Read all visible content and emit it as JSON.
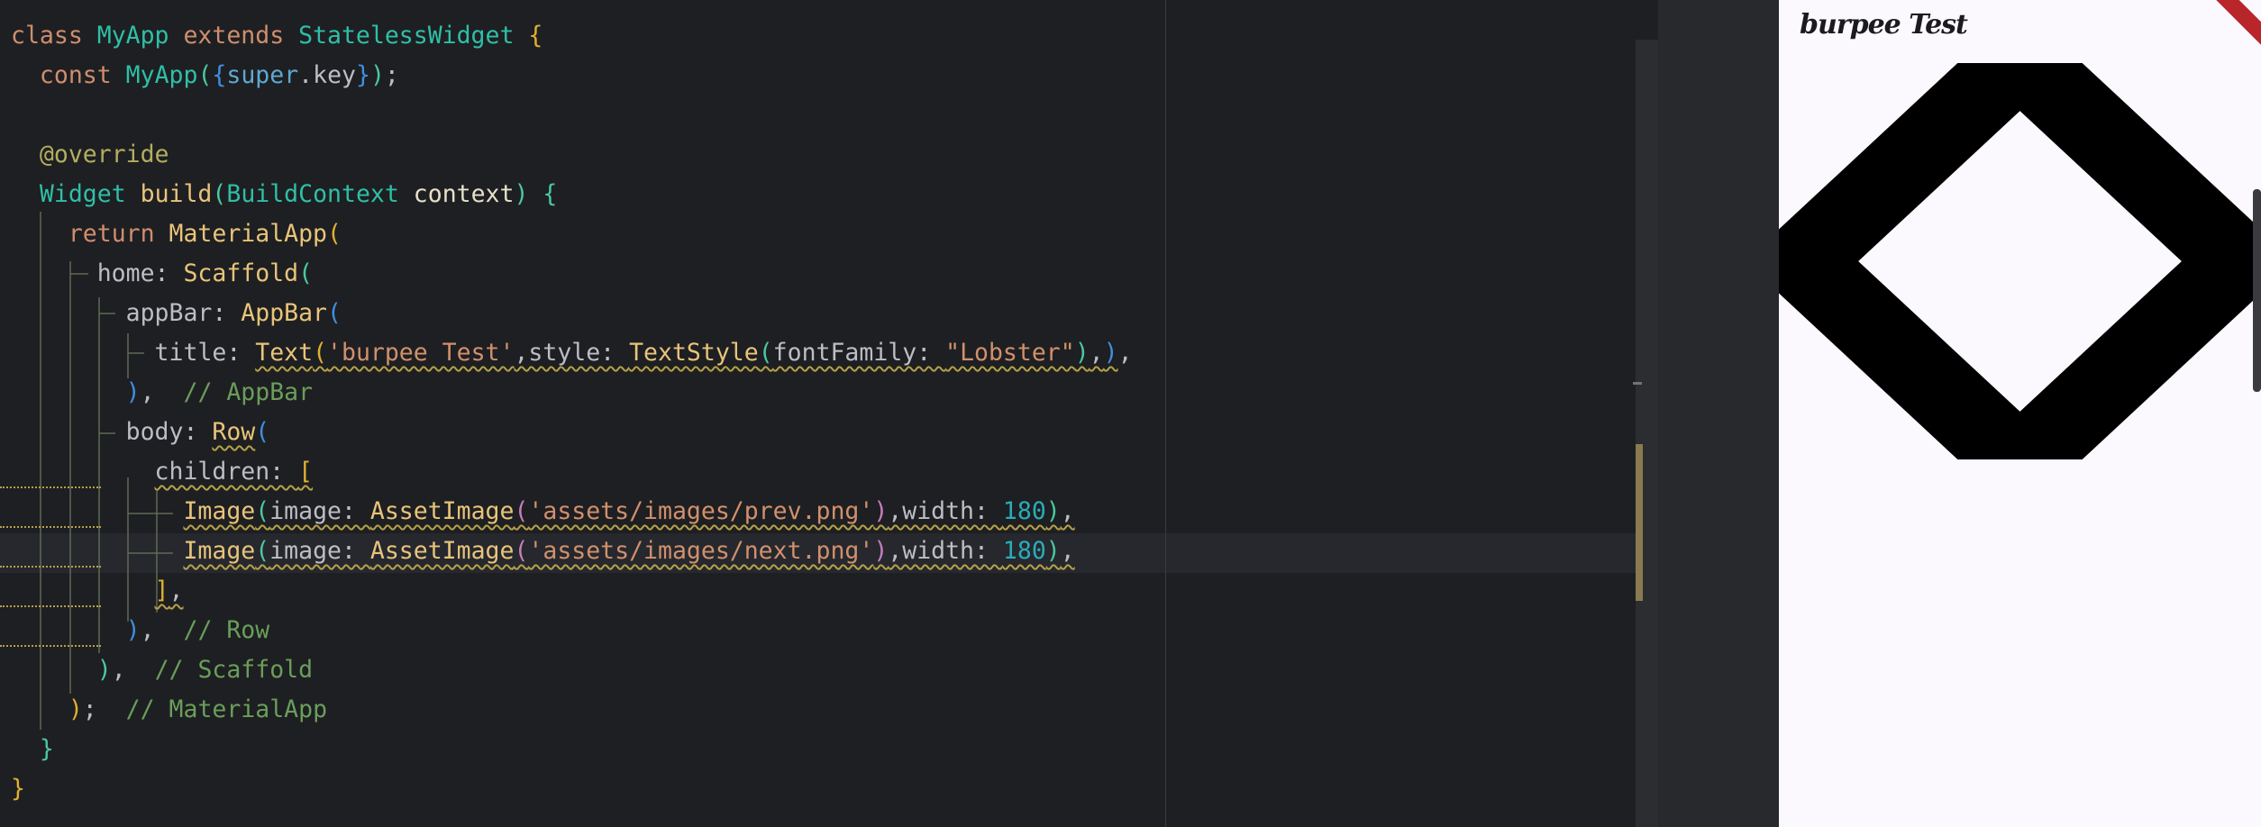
{
  "editor": {
    "lines": [
      {
        "warn": false,
        "tokens": [
          {
            "t": "class ",
            "c": "c-kw"
          },
          {
            "t": "MyApp ",
            "c": "c-type"
          },
          {
            "t": "extends ",
            "c": "c-kw"
          },
          {
            "t": "StatelessWidget ",
            "c": "c-type"
          },
          {
            "t": "{",
            "c": "c-p1"
          }
        ]
      },
      {
        "warn": false,
        "tokens": [
          {
            "t": "  "
          },
          {
            "t": "const ",
            "c": "c-kw"
          },
          {
            "t": "MyApp",
            "c": "c-type"
          },
          {
            "t": "(",
            "c": "c-p2"
          },
          {
            "t": "{",
            "c": "c-p3"
          },
          {
            "t": "super",
            "c": "c-kw2"
          },
          {
            "t": ".key"
          },
          {
            "t": "}",
            "c": "c-p3"
          },
          {
            "t": ")",
            "c": "c-p2"
          },
          {
            "t": ";"
          }
        ]
      },
      {
        "warn": false,
        "tokens": []
      },
      {
        "warn": false,
        "tokens": [
          {
            "t": "  "
          },
          {
            "t": "@override",
            "c": "c-ann"
          }
        ]
      },
      {
        "warn": false,
        "tokens": [
          {
            "t": "  "
          },
          {
            "t": "Widget ",
            "c": "c-type"
          },
          {
            "t": "build",
            "c": "c-fn"
          },
          {
            "t": "(",
            "c": "c-p2"
          },
          {
            "t": "BuildContext ",
            "c": "c-type"
          },
          {
            "t": "context",
            "c": "c-prm"
          },
          {
            "t": ") ",
            "c": "c-p2"
          },
          {
            "t": "{",
            "c": "c-p2"
          }
        ]
      },
      {
        "warn": false,
        "tokens": [
          {
            "t": "    "
          },
          {
            "t": "return ",
            "c": "c-kw"
          },
          {
            "t": "MaterialApp",
            "c": "c-fn"
          },
          {
            "t": "(",
            "c": "c-p1"
          }
        ]
      },
      {
        "warn": false,
        "tokens": [
          {
            "t": "      home: "
          },
          {
            "t": "Scaffold",
            "c": "c-fn"
          },
          {
            "t": "(",
            "c": "c-p2"
          }
        ]
      },
      {
        "warn": false,
        "tokens": [
          {
            "t": "        appBar: "
          },
          {
            "t": "AppBar",
            "c": "c-fn"
          },
          {
            "t": "(",
            "c": "c-p3"
          }
        ]
      },
      {
        "warn": false,
        "tokens": [
          {
            "t": "          title: "
          },
          {
            "t": "Text",
            "c": "c-fn",
            "w": true
          },
          {
            "t": "(",
            "c": "c-p1",
            "w": true
          },
          {
            "t": "'burpee Test'",
            "c": "c-str",
            "w": true
          },
          {
            "t": ",style: ",
            "w": true
          },
          {
            "t": "TextStyle",
            "c": "c-fn",
            "w": true
          },
          {
            "t": "(",
            "c": "c-p2",
            "w": true
          },
          {
            "t": "fontFamily: ",
            "w": true
          },
          {
            "t": "\"Lobster\"",
            "c": "c-str",
            "w": true
          },
          {
            "t": ")",
            "c": "c-p2",
            "w": true
          },
          {
            "t": ",",
            "w": true
          },
          {
            "t": ")",
            "c": "c-p3",
            "w": true
          },
          {
            "t": ","
          }
        ]
      },
      {
        "warn": false,
        "tokens": [
          {
            "t": "        "
          },
          {
            "t": ")",
            "c": "c-p3"
          },
          {
            "t": ",  "
          },
          {
            "t": "// AppBar",
            "c": "c-cm"
          }
        ]
      },
      {
        "warn": false,
        "tokens": [
          {
            "t": "        body: "
          },
          {
            "t": "Row",
            "c": "c-fn",
            "w": true
          },
          {
            "t": "(",
            "c": "c-p3"
          }
        ]
      },
      {
        "warn": true,
        "tokens": [
          {
            "t": "          "
          },
          {
            "t": "children: ",
            "w": true
          },
          {
            "t": "[",
            "c": "c-p1",
            "w": true
          }
        ]
      },
      {
        "warn": true,
        "tokens": [
          {
            "t": "            "
          },
          {
            "t": "Image",
            "c": "c-fn",
            "w": true
          },
          {
            "t": "(",
            "c": "c-p2",
            "w": true
          },
          {
            "t": "image: ",
            "w": true
          },
          {
            "t": "AssetImage",
            "c": "c-fn",
            "w": true
          },
          {
            "t": "(",
            "c": "c-p4",
            "w": true
          },
          {
            "t": "'assets/images/prev.png'",
            "c": "c-str",
            "w": true
          },
          {
            "t": ")",
            "c": "c-p4",
            "w": true
          },
          {
            "t": ",width: ",
            "w": true
          },
          {
            "t": "180",
            "c": "c-num",
            "w": true
          },
          {
            "t": ")",
            "c": "c-p2",
            "w": true
          },
          {
            "t": ",",
            "w": true
          }
        ]
      },
      {
        "warn": true,
        "tokens": [
          {
            "t": "            "
          },
          {
            "t": "Image",
            "c": "c-fn",
            "w": true
          },
          {
            "t": "(",
            "c": "c-p2",
            "w": true
          },
          {
            "t": "image: ",
            "w": true
          },
          {
            "t": "AssetImage",
            "c": "c-fn",
            "w": true
          },
          {
            "t": "(",
            "c": "c-p4",
            "w": true
          },
          {
            "t": "'assets/images/next.png'",
            "c": "c-str",
            "w": true
          },
          {
            "t": ")",
            "c": "c-p4",
            "w": true
          },
          {
            "t": ",width: ",
            "w": true
          },
          {
            "t": "180",
            "c": "c-num",
            "w": true
          },
          {
            "t": ")",
            "c": "c-p2",
            "w": true
          },
          {
            "t": ",",
            "w": true
          }
        ]
      },
      {
        "warn": true,
        "tokens": [
          {
            "t": "          "
          },
          {
            "t": "]",
            "c": "c-p1",
            "w": true
          },
          {
            "t": ",",
            "w": true
          }
        ]
      },
      {
        "warn": true,
        "tokens": [
          {
            "t": "        "
          },
          {
            "t": ")",
            "c": "c-p3"
          },
          {
            "t": ",  "
          },
          {
            "t": "// Row",
            "c": "c-cm"
          }
        ]
      },
      {
        "warn": false,
        "tokens": [
          {
            "t": "      "
          },
          {
            "t": ")",
            "c": "c-p2"
          },
          {
            "t": ",  "
          },
          {
            "t": "// Scaffold",
            "c": "c-cm"
          }
        ]
      },
      {
        "warn": false,
        "tokens": [
          {
            "t": "    "
          },
          {
            "t": ")",
            "c": "c-p1"
          },
          {
            "t": ";  "
          },
          {
            "t": "// MaterialApp",
            "c": "c-cm"
          }
        ]
      },
      {
        "warn": false,
        "tokens": [
          {
            "t": "  "
          },
          {
            "t": "}",
            "c": "c-p2"
          }
        ]
      },
      {
        "warn": false,
        "tokens": [
          {
            "t": "}",
            "c": "c-p1"
          }
        ]
      }
    ]
  },
  "emulator": {
    "app_title": "burpee Test",
    "images": [
      {
        "name": "prev-arrow",
        "icon": "chevron-left-icon"
      },
      {
        "name": "next-arrow",
        "icon": "chevron-right-icon"
      }
    ],
    "debug_banner_color": "#b8262b",
    "background_color": "#fbf8fe"
  }
}
